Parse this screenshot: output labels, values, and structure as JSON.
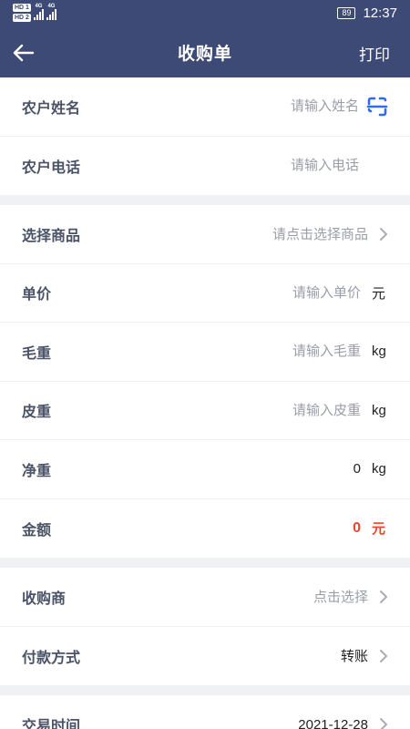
{
  "status_bar": {
    "sim1": "HD 1",
    "sim2": "HD 2",
    "network1": "4G",
    "network2": "4G",
    "battery": "89",
    "time": "12:37"
  },
  "header": {
    "back_icon": "arrow-left-icon",
    "title": "收购单",
    "print_label": "打印"
  },
  "farmer": {
    "name_label": "农户姓名",
    "name_placeholder": "请输入姓名",
    "scan_icon": "scan-icon",
    "phone_label": "农户电话",
    "phone_placeholder": "请输入电话"
  },
  "goods": {
    "product_label": "选择商品",
    "product_placeholder": "请点击选择商品",
    "price_label": "单价",
    "price_placeholder": "请输入单价",
    "price_unit": "元",
    "gross_label": "毛重",
    "gross_placeholder": "请输入毛重",
    "gross_unit": "kg",
    "tare_label": "皮重",
    "tare_placeholder": "请输入皮重",
    "tare_unit": "kg",
    "net_label": "净重",
    "net_value": "0",
    "net_unit": "kg",
    "amount_label": "金额",
    "amount_value": "0",
    "amount_unit": "元"
  },
  "purchase": {
    "buyer_label": "收购商",
    "buyer_placeholder": "点击选择",
    "payment_label": "付款方式",
    "payment_value": "转账"
  },
  "trade": {
    "date_label": "交易时间",
    "date_value": "2021-12-28"
  },
  "colors": {
    "header_bg": "#3d4a75",
    "accent_red": "#f2432b",
    "scan_blue": "#2f6bf0"
  }
}
